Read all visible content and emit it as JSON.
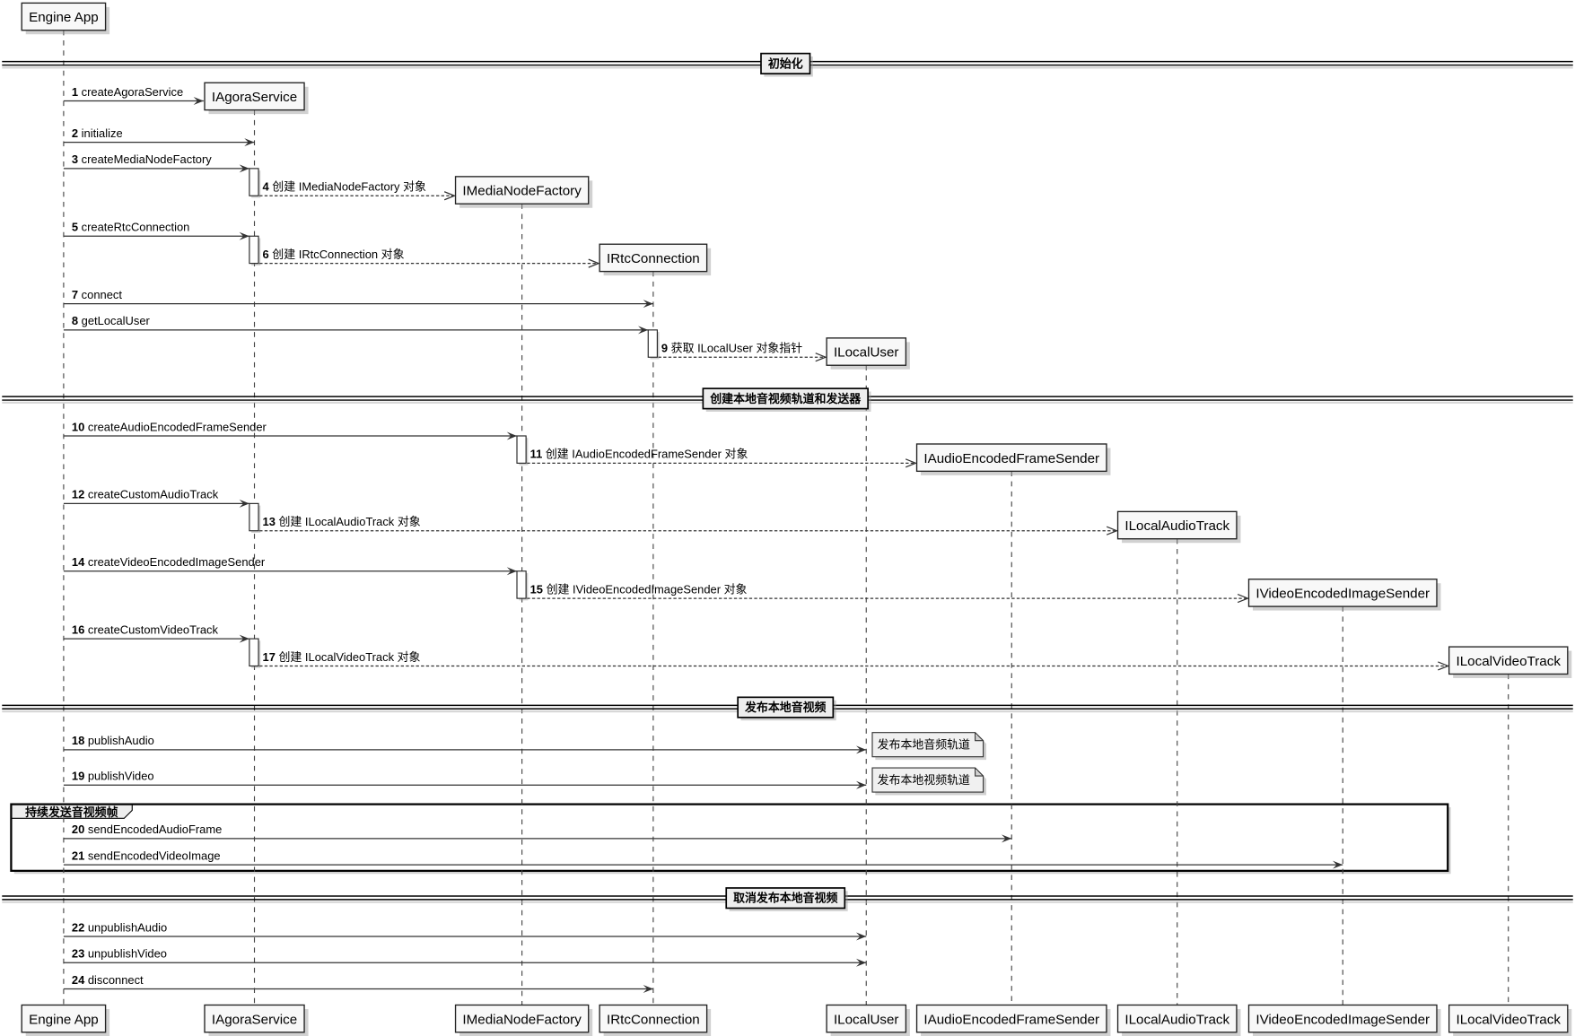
{
  "participants": [
    "Engine App",
    "IAgoraService",
    "IMediaNodeFactory",
    "IRtcConnection",
    "ILocalUser",
    "IAudioEncodedFrameSender",
    "ILocalAudioTrack",
    "IVideoEncodedImageSender",
    "ILocalVideoTrack"
  ],
  "dividers": [
    "初始化",
    "创建本地音视频轨道和发送器",
    "发布本地音视频",
    "取消发布本地音视频"
  ],
  "messages": [
    {
      "n": "1",
      "label": "createAgoraService",
      "from": 0,
      "to": 1,
      "dashed": false
    },
    {
      "n": "2",
      "label": "initialize",
      "from": 0,
      "to": 1,
      "dashed": false
    },
    {
      "n": "3",
      "label": "createMediaNodeFactory",
      "from": 0,
      "to": 1,
      "dashed": false
    },
    {
      "n": "4",
      "label": "创建 IMediaNodeFactory 对象",
      "from": 1,
      "to": 2,
      "dashed": true
    },
    {
      "n": "5",
      "label": "createRtcConnection",
      "from": 0,
      "to": 1,
      "dashed": false
    },
    {
      "n": "6",
      "label": "创建 IRtcConnection 对象",
      "from": 1,
      "to": 3,
      "dashed": true
    },
    {
      "n": "7",
      "label": "connect",
      "from": 0,
      "to": 3,
      "dashed": false
    },
    {
      "n": "8",
      "label": "getLocalUser",
      "from": 0,
      "to": 3,
      "dashed": false
    },
    {
      "n": "9",
      "label": "获取 ILocalUser 对象指针",
      "from": 3,
      "to": 4,
      "dashed": true
    },
    {
      "n": "10",
      "label": "createAudioEncodedFrameSender",
      "from": 0,
      "to": 2,
      "dashed": false
    },
    {
      "n": "11",
      "label": "创建 IAudioEncodedFrameSender 对象",
      "from": 2,
      "to": 5,
      "dashed": true
    },
    {
      "n": "12",
      "label": "createCustomAudioTrack",
      "from": 0,
      "to": 1,
      "dashed": false
    },
    {
      "n": "13",
      "label": "创建 ILocalAudioTrack 对象",
      "from": 1,
      "to": 6,
      "dashed": true
    },
    {
      "n": "14",
      "label": "createVideoEncodedImageSender",
      "from": 0,
      "to": 2,
      "dashed": false
    },
    {
      "n": "15",
      "label": "创建 IVideoEncodedImageSender 对象",
      "from": 2,
      "to": 7,
      "dashed": true
    },
    {
      "n": "16",
      "label": "createCustomVideoTrack",
      "from": 0,
      "to": 1,
      "dashed": false
    },
    {
      "n": "17",
      "label": "创建 ILocalVideoTrack 对象",
      "from": 1,
      "to": 8,
      "dashed": true
    },
    {
      "n": "18",
      "label": "publishAudio",
      "from": 0,
      "to": 4,
      "dashed": false
    },
    {
      "n": "19",
      "label": "publishVideo",
      "from": 0,
      "to": 4,
      "dashed": false
    },
    {
      "n": "20",
      "label": "sendEncodedAudioFrame",
      "from": 0,
      "to": 5,
      "dashed": false
    },
    {
      "n": "21",
      "label": "sendEncodedVideoImage",
      "from": 0,
      "to": 7,
      "dashed": false
    },
    {
      "n": "22",
      "label": "unpublishAudio",
      "from": 0,
      "to": 4,
      "dashed": false
    },
    {
      "n": "23",
      "label": "unpublishVideo",
      "from": 0,
      "to": 4,
      "dashed": false
    },
    {
      "n": "24",
      "label": "disconnect",
      "from": 0,
      "to": 3,
      "dashed": false
    }
  ],
  "notes": [
    {
      "text": "发布本地音频轨道",
      "message": "18"
    },
    {
      "text": "发布本地视频轨道",
      "message": "19"
    }
  ],
  "group": {
    "label": "持续发送音视频帧"
  }
}
